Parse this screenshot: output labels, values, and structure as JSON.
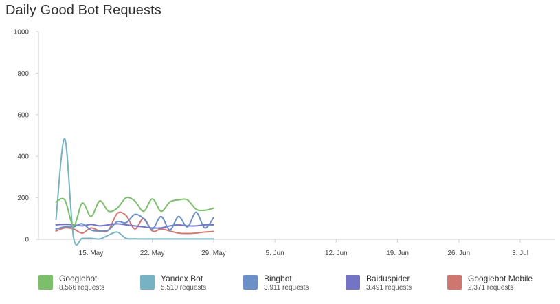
{
  "title": "Daily Good Bot Requests",
  "chart_data": {
    "type": "line",
    "title": "Daily Good Bot Requests",
    "xlabel": "",
    "ylabel": "",
    "ylim": [
      0,
      1000
    ],
    "yticks": [
      "0",
      "200",
      "400",
      "600",
      "800",
      "1000"
    ],
    "xlim": [
      "2024-05-09",
      "2024-07-07"
    ],
    "xticks": [
      {
        "date": "2024-05-15",
        "label": "15. May"
      },
      {
        "date": "2024-05-22",
        "label": "22. May"
      },
      {
        "date": "2024-05-29",
        "label": "29. May"
      },
      {
        "date": "2024-06-05",
        "label": "5. Jun"
      },
      {
        "date": "2024-06-12",
        "label": "12. Jun"
      },
      {
        "date": "2024-06-19",
        "label": "19. Jun"
      },
      {
        "date": "2024-06-26",
        "label": "26. Jun"
      },
      {
        "date": "2024-07-03",
        "label": "3. Jul"
      }
    ],
    "x": [
      "2024-05-11",
      "2024-05-12",
      "2024-05-13",
      "2024-05-14",
      "2024-05-15",
      "2024-05-16",
      "2024-05-17",
      "2024-05-18",
      "2024-05-19",
      "2024-05-20",
      "2024-05-21",
      "2024-05-22",
      "2024-05-23",
      "2024-05-24",
      "2024-05-25",
      "2024-05-26",
      "2024-05-27",
      "2024-05-28",
      "2024-05-29"
    ],
    "series": [
      {
        "name": "Googlebot",
        "color": "#7cbf6b",
        "total": "8,566 requests",
        "values": [
          180,
          190,
          65,
          175,
          110,
          185,
          135,
          150,
          200,
          185,
          135,
          195,
          135,
          180,
          190,
          190,
          145,
          140,
          150
        ]
      },
      {
        "name": "Yandex Bot",
        "color": "#77b2c4",
        "total": "5,510 requests",
        "values": [
          95,
          485,
          10,
          5,
          5,
          2,
          20,
          35,
          5,
          3,
          2,
          2,
          2,
          2,
          2,
          2,
          2,
          2,
          2
        ]
      },
      {
        "name": "Bingbot",
        "color": "#6b8fc7",
        "total": "3,911 requests",
        "values": [
          50,
          60,
          60,
          75,
          45,
          40,
          45,
          85,
          80,
          120,
          100,
          50,
          110,
          45,
          110,
          60,
          130,
          55,
          105
        ]
      },
      {
        "name": "Baiduspider",
        "color": "#7474c6",
        "total": "3,491 requests",
        "values": [
          70,
          72,
          70,
          65,
          72,
          65,
          70,
          75,
          70,
          65,
          60,
          55,
          55,
          65,
          70,
          65,
          65,
          70,
          70
        ]
      },
      {
        "name": "Googlebot Mobile",
        "color": "#d07670",
        "total": "2,371 requests",
        "values": [
          40,
          55,
          50,
          30,
          55,
          40,
          45,
          125,
          115,
          50,
          100,
          40,
          50,
          40,
          30,
          28,
          30,
          35,
          38
        ]
      }
    ],
    "grid": false,
    "legend": "bottom"
  }
}
